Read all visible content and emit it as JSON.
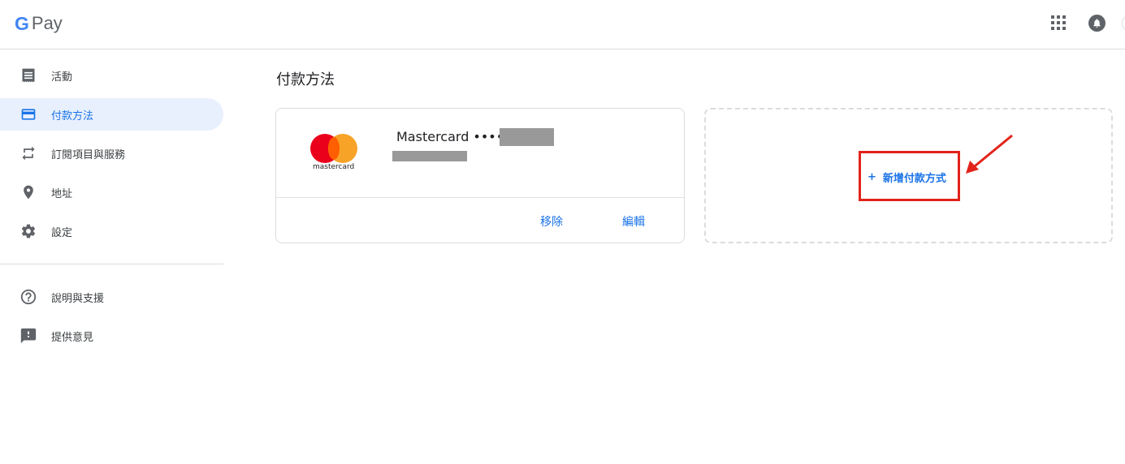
{
  "header": {
    "logo_g": "G",
    "logo_text": "Pay"
  },
  "sidebar": {
    "items": [
      {
        "label": "活動",
        "icon": "receipt-icon"
      },
      {
        "label": "付款方法",
        "icon": "credit-card-icon",
        "active": true
      },
      {
        "label": "訂閱項目與服務",
        "icon": "repeat-icon"
      },
      {
        "label": "地址",
        "icon": "location-pin-icon"
      },
      {
        "label": "設定",
        "icon": "gear-icon"
      }
    ],
    "secondary": [
      {
        "label": "說明與支援",
        "icon": "help-circle-icon"
      },
      {
        "label": "提供意見",
        "icon": "feedback-icon"
      }
    ]
  },
  "main": {
    "title": "付款方法",
    "card": {
      "brand_logo_text": "mastercard",
      "name": "Mastercard ••••",
      "remove_label": "移除",
      "edit_label": "編輯"
    },
    "add": {
      "plus": "+",
      "label": "新增付款方式"
    }
  },
  "colors": {
    "accent": "#1a73e8",
    "active_bg": "#e8f0fe",
    "highlight": "#e2231a"
  }
}
